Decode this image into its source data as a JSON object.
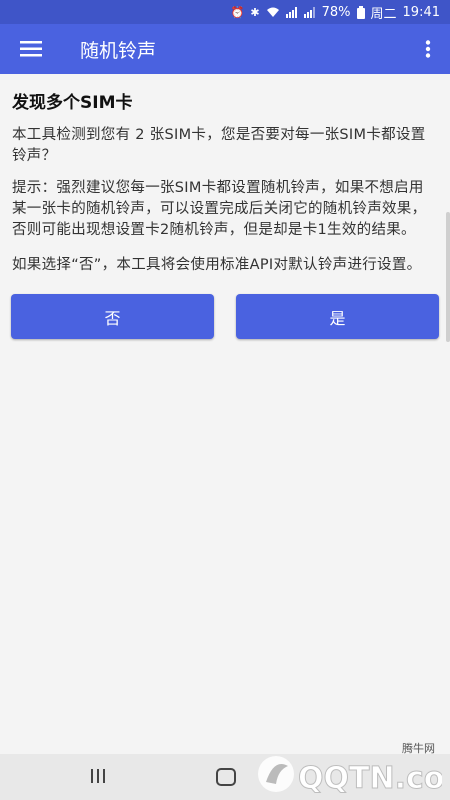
{
  "statusbar": {
    "battery": "78%",
    "day": "周二",
    "time": "19:41"
  },
  "appbar": {
    "title": "随机铃声"
  },
  "dialog": {
    "heading": "发现多个SIM卡",
    "para1": "本工具检测到您有 2 张SIM卡，您是否要对每一张SIM卡都设置铃声？",
    "para2": "提示：强烈建议您每一张SIM卡都设置随机铃声，如果不想启用某一张卡的随机铃声，可以设置完成后关闭它的随机铃声效果，否则可能出现想设置卡2随机铃声，但是却是卡1生效的结果。",
    "para3": "如果选择“否”，本工具将会使用标准API对默认铃声进行设置。",
    "no_label": "否",
    "yes_label": "是"
  },
  "watermark": {
    "small_text": "腾牛网",
    "logo_text": "QQTN.com"
  },
  "colors": {
    "appbar": "#4a62e0",
    "statusbar": "#3f55c8",
    "button": "#4a62e0"
  }
}
